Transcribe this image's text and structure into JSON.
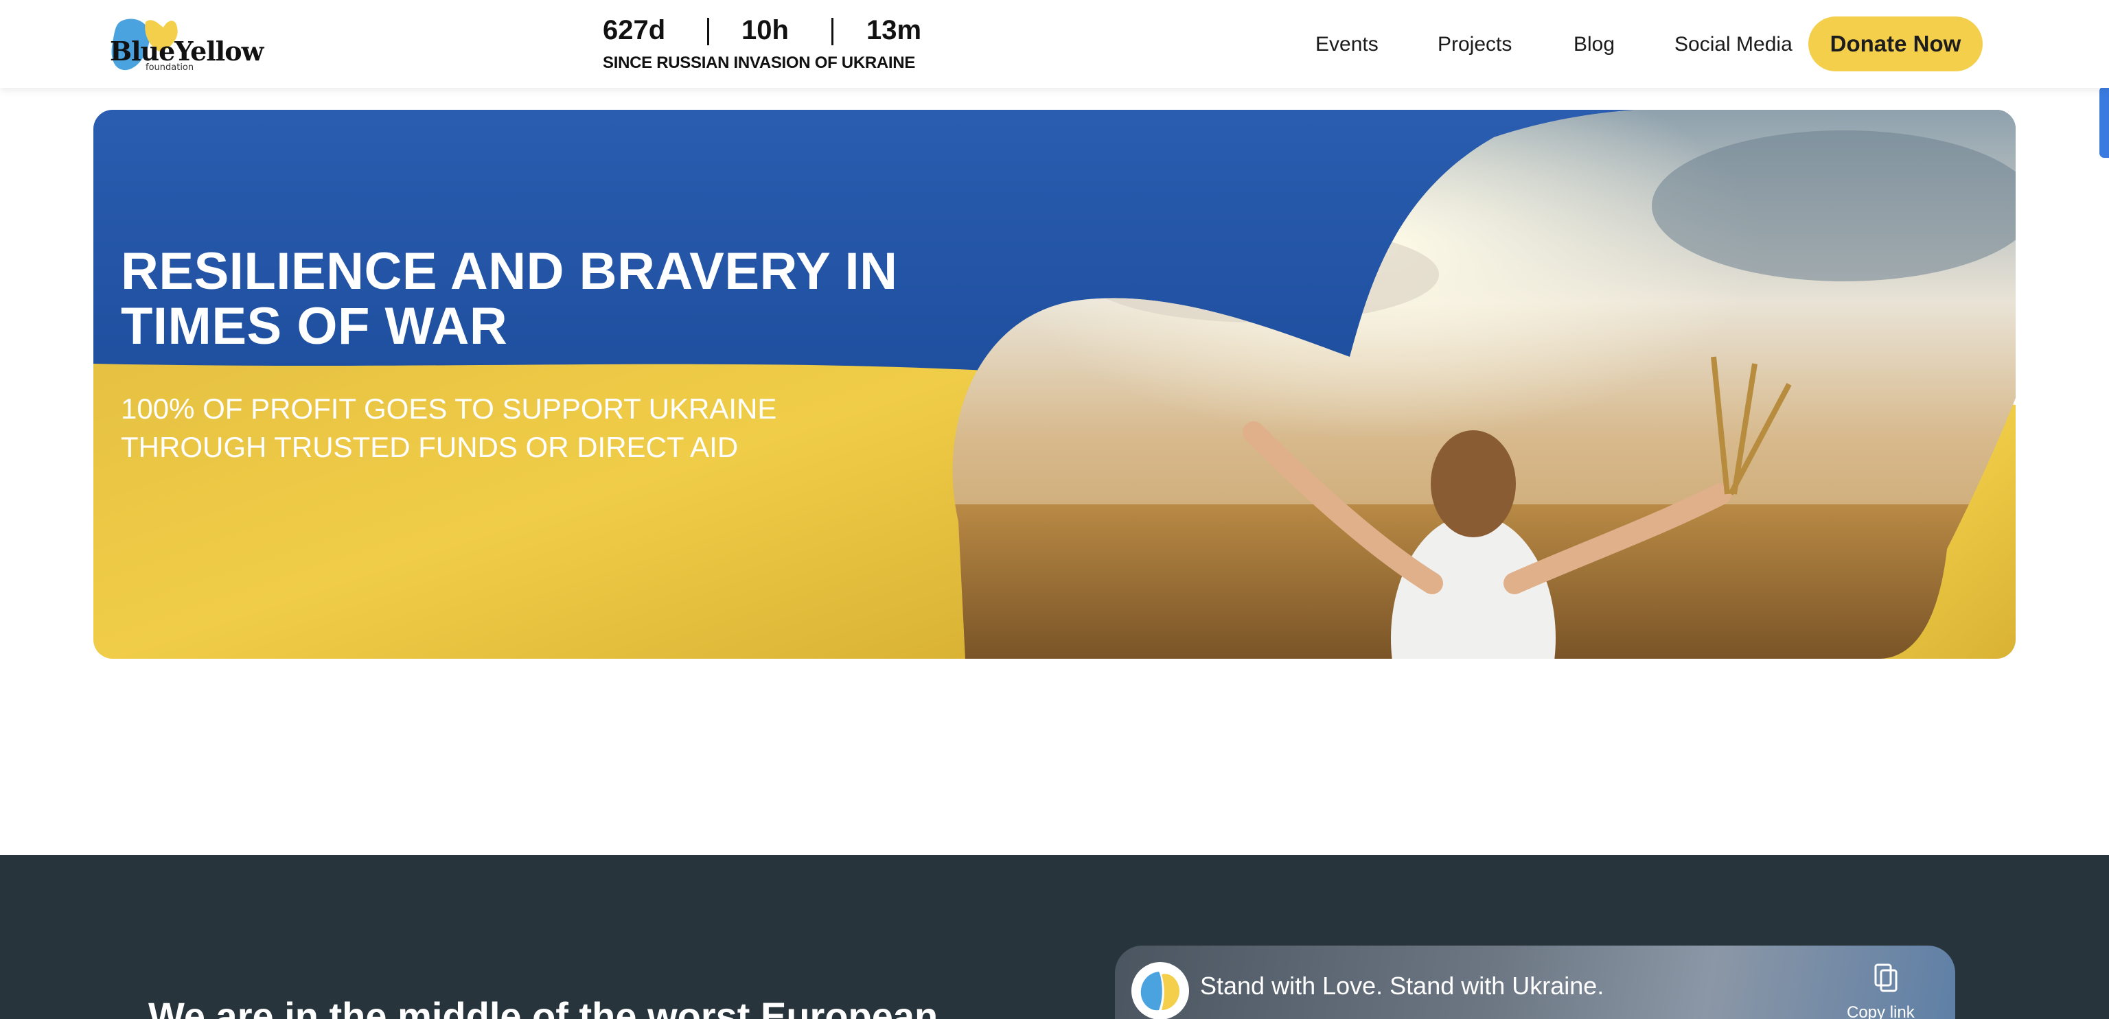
{
  "header": {
    "logo_text": "BlueYellow",
    "logo_sub": "foundation",
    "counter": {
      "days": "627d",
      "hours": "10h",
      "minutes": "13m",
      "since": "SINCE RUSSIAN INVASION OF UKRAINE"
    },
    "nav": [
      "Events",
      "Projects",
      "Blog",
      "Social Media"
    ],
    "donate_label": "Donate Now"
  },
  "hero": {
    "title": "RESILIENCE AND BRAVERY IN TIMES OF WAR",
    "subtitle": "100% OF PROFIT GOES TO SUPPORT UKRAINE THROUGH TRUSTED FUNDS OR DIRECT AID"
  },
  "mission": {
    "heading": "We are in the middle of the worst European"
  },
  "video": {
    "title": "Stand with Love. Stand with Ukraine.",
    "copy_label": "Copy link"
  },
  "colors": {
    "blue": "#2a5db0",
    "yellow": "#f4cf4c",
    "dark": "#28343b"
  }
}
